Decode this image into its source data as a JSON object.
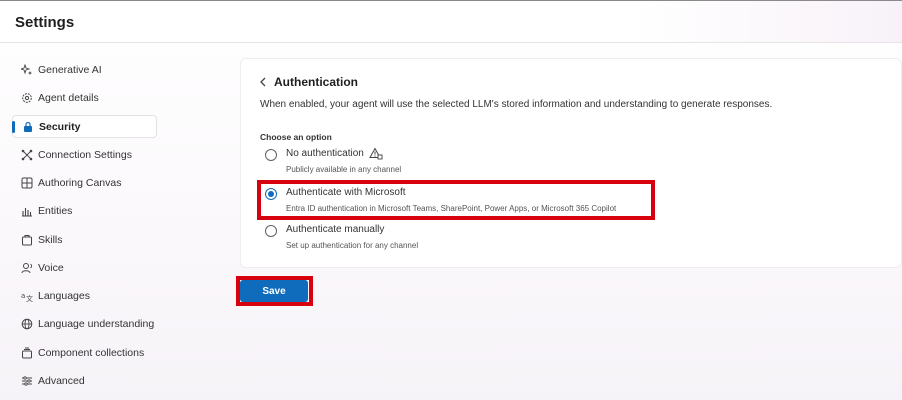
{
  "header": {
    "title": "Settings"
  },
  "sidebar": {
    "items": [
      {
        "label": "Generative AI",
        "icon": "sparkle-icon"
      },
      {
        "label": "Agent details",
        "icon": "gear-icon"
      },
      {
        "label": "Security",
        "icon": "lock-icon",
        "active": true
      },
      {
        "label": "Connection Settings",
        "icon": "connection-icon"
      },
      {
        "label": "Authoring Canvas",
        "icon": "grid-icon"
      },
      {
        "label": "Entities",
        "icon": "entities-icon"
      },
      {
        "label": "Skills",
        "icon": "skills-icon"
      },
      {
        "label": "Voice",
        "icon": "voice-icon"
      },
      {
        "label": "Languages",
        "icon": "languages-icon"
      },
      {
        "label": "Language understanding",
        "icon": "globe-icon"
      },
      {
        "label": "Component collections",
        "icon": "collection-icon"
      },
      {
        "label": "Advanced",
        "icon": "sliders-icon"
      }
    ]
  },
  "auth": {
    "title": "Authentication",
    "description": "When enabled, your agent will use the selected LLM's stored information and understanding to generate responses.",
    "choose_label": "Choose an option",
    "options": [
      {
        "title": "No authentication",
        "subtitle": "Publicly available in any channel",
        "selected": false
      },
      {
        "title": "Authenticate with Microsoft",
        "subtitle": "Entra ID authentication in Microsoft Teams, SharePoint, Power Apps, or Microsoft 365 Copilot",
        "selected": true
      },
      {
        "title": "Authenticate manually",
        "subtitle": "Set up authentication for any channel",
        "selected": false
      }
    ]
  },
  "actions": {
    "save_label": "Save"
  },
  "colors": {
    "accent": "#0f6cbd",
    "highlight": "#d6000e"
  }
}
